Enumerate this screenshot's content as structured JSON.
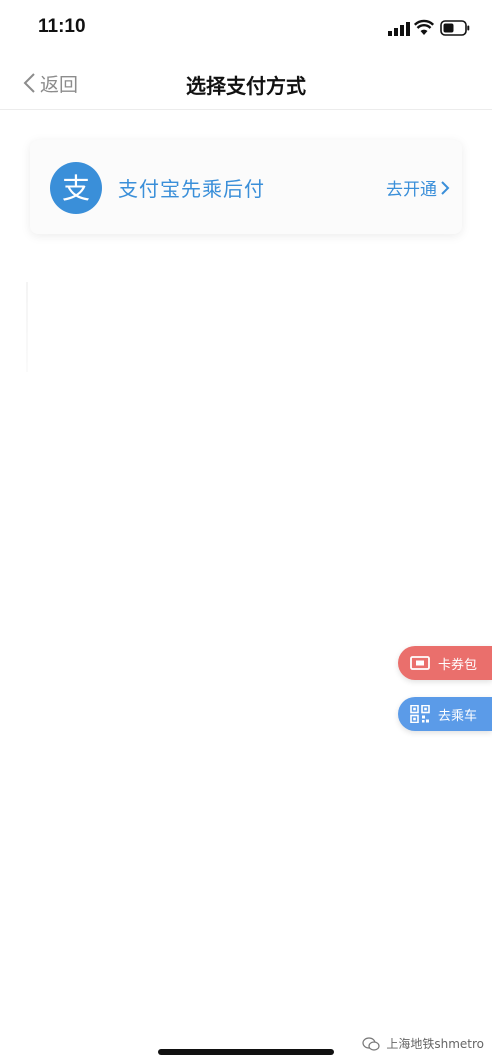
{
  "status_bar": {
    "time": "11:10"
  },
  "nav": {
    "back_label": "返回",
    "title": "选择支付方式"
  },
  "payment_option": {
    "name": "支付宝先乘后付",
    "action_label": "去开通",
    "logo_char": "支",
    "accent_color": "#3a8fd9"
  },
  "floating_buttons": {
    "card_wallet_label": "卡券包",
    "ride_label": "去乘车",
    "card_wallet_color": "#ea6f6c",
    "ride_color": "#5b9be8"
  },
  "watermark": {
    "text": "上海地铁shmetro"
  }
}
